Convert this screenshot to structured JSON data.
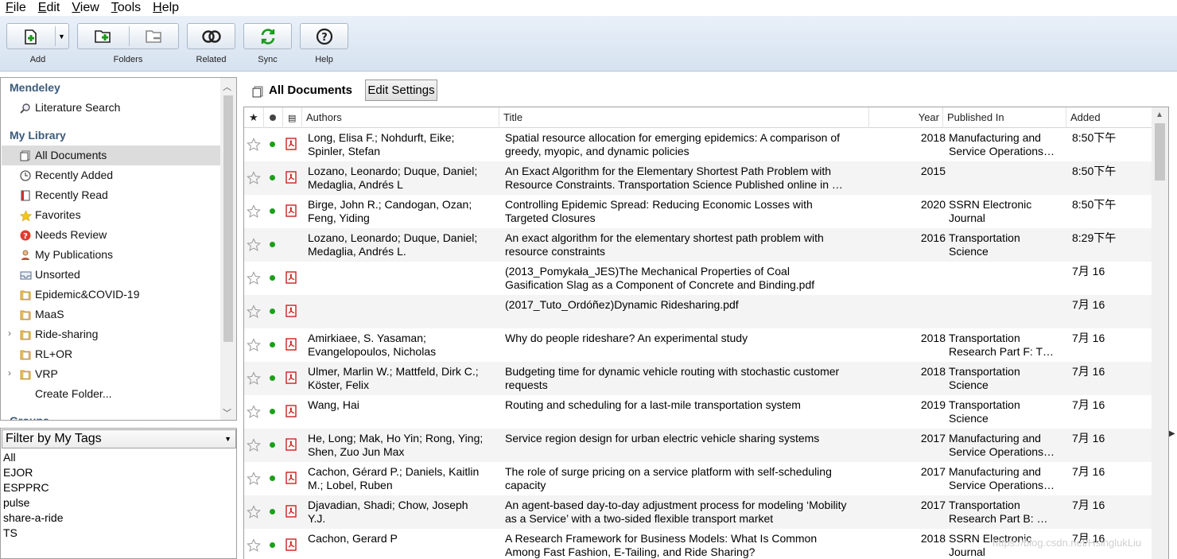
{
  "menu": {
    "file": {
      "u": "F",
      "rest": "ile"
    },
    "edit": {
      "u": "E",
      "rest": "dit"
    },
    "view": {
      "u": "V",
      "rest": "iew"
    },
    "tools": {
      "u": "T",
      "rest": "ools"
    },
    "help": {
      "u": "H",
      "rest": "elp"
    }
  },
  "toolbar": {
    "add": "Add",
    "folders": "Folders",
    "related": "Related",
    "sync": "Sync",
    "help": "Help"
  },
  "sidebar": {
    "mendeley_header": "Mendeley",
    "literature_search": "Literature Search",
    "library_header": "My Library",
    "items": [
      {
        "label": "All Documents"
      },
      {
        "label": "Recently Added"
      },
      {
        "label": "Recently Read"
      },
      {
        "label": "Favorites"
      },
      {
        "label": "Needs Review"
      },
      {
        "label": "My Publications"
      },
      {
        "label": "Unsorted"
      },
      {
        "label": "Epidemic&COVID-19"
      },
      {
        "label": "MaaS"
      },
      {
        "label": "Ride-sharing"
      },
      {
        "label": "RL+OR"
      },
      {
        "label": "VRP"
      },
      {
        "label": "Create Folder..."
      }
    ],
    "groups_header": "Groups"
  },
  "tags": {
    "filter_label": "Filter by My Tags",
    "list": [
      "All",
      "EJOR",
      "ESPPRC",
      "pulse",
      "share-a-ride",
      "TS"
    ]
  },
  "docs_header": {
    "title": "All Documents",
    "edit_settings": "Edit Settings"
  },
  "table": {
    "columns": {
      "authors": "Authors",
      "title": "Title",
      "year": "Year",
      "published_in": "Published In",
      "added": "Added"
    },
    "rows": [
      {
        "authors": [
          "Long, Elisa F.; Nohdurft, Eike;",
          "Spinler, Stefan"
        ],
        "title": [
          "Spatial resource allocation for emerging epidemics: A comparison of",
          "greedy, myopic, and dynamic policies"
        ],
        "year": "2018",
        "pub": [
          "Manufacturing and",
          "Service Operations…"
        ],
        "added": "8:50下午",
        "pdf": true
      },
      {
        "authors": [
          "Lozano, Leonardo; Duque, Daniel;",
          "Medaglia, Andrés L"
        ],
        "title": [
          "An Exact Algorithm for the Elementary Shortest Path Problem with",
          "Resource Constraints. Transportation Science Published online in …"
        ],
        "year": "2015",
        "pub": [
          "",
          ""
        ],
        "added": "8:50下午",
        "pdf": true
      },
      {
        "authors": [
          "Birge, John R.; Candogan, Ozan;",
          "Feng, Yiding"
        ],
        "title": [
          "Controlling Epidemic Spread: Reducing Economic Losses with",
          "Targeted Closures"
        ],
        "year": "2020",
        "pub": [
          "SSRN Electronic",
          "Journal"
        ],
        "added": "8:50下午",
        "pdf": true
      },
      {
        "authors": [
          "Lozano, Leonardo; Duque, Daniel;",
          "Medaglia, Andrés L."
        ],
        "title": [
          "An exact algorithm for the elementary shortest path problem with",
          "resource constraints"
        ],
        "year": "2016",
        "pub": [
          "Transportation",
          "Science"
        ],
        "added": "8:29下午",
        "pdf": false
      },
      {
        "authors": [
          "",
          ""
        ],
        "title": [
          "(2013_Pomykała_JES)The Mechanical Properties of Coal",
          "Gasification Slag as a Component of Concrete and Binding.pdf"
        ],
        "year": "",
        "pub": [
          "",
          ""
        ],
        "added": "7月 16",
        "pdf": true
      },
      {
        "authors": [
          "",
          ""
        ],
        "title": [
          "(2017_Tuto_Ordóñez)Dynamic Ridesharing.pdf",
          ""
        ],
        "year": "",
        "pub": [
          "",
          ""
        ],
        "added": "7月 16",
        "pdf": true
      },
      {
        "authors": [
          "Amirkiaee, S. Yasaman;",
          "Evangelopoulos, Nicholas"
        ],
        "title": [
          "Why do people rideshare? An experimental study",
          ""
        ],
        "year": "2018",
        "pub": [
          "Transportation",
          "Research Part F: T…"
        ],
        "added": "7月 16",
        "pdf": true
      },
      {
        "authors": [
          "Ulmer, Marlin W.; Mattfeld, Dirk C.;",
          "Köster, Felix"
        ],
        "title": [
          "Budgeting time for dynamic vehicle routing with stochastic customer",
          "requests"
        ],
        "year": "2018",
        "pub": [
          "Transportation",
          "Science"
        ],
        "added": "7月 16",
        "pdf": true
      },
      {
        "authors": [
          "Wang, Hai",
          ""
        ],
        "title": [
          "Routing and scheduling for a last-mile transportation system",
          ""
        ],
        "year": "2019",
        "pub": [
          "Transportation",
          "Science"
        ],
        "added": "7月 16",
        "pdf": true
      },
      {
        "authors": [
          "He, Long; Mak, Ho Yin; Rong, Ying;",
          "Shen, Zuo Jun Max"
        ],
        "title": [
          "Service region design for urban electric vehicle sharing systems",
          ""
        ],
        "year": "2017",
        "pub": [
          "Manufacturing and",
          "Service Operations…"
        ],
        "added": "7月 16",
        "pdf": true
      },
      {
        "authors": [
          "Cachon, Gérard P.; Daniels, Kaitlin",
          "M.; Lobel, Ruben"
        ],
        "title": [
          "The role of surge pricing on a service platform with self-scheduling",
          "capacity"
        ],
        "year": "2017",
        "pub": [
          "Manufacturing and",
          "Service Operations…"
        ],
        "added": "7月 16",
        "pdf": true
      },
      {
        "authors": [
          "Djavadian, Shadi; Chow, Joseph",
          "Y.J."
        ],
        "title": [
          "An agent-based day-to-day adjustment process for modeling ‘Mobility",
          "as a Service’ with a two-sided flexible transport market"
        ],
        "year": "2017",
        "pub": [
          "Transportation",
          "Research Part B: …"
        ],
        "added": "7月 16",
        "pdf": true
      },
      {
        "authors": [
          "Cachon, Gerard P",
          ""
        ],
        "title": [
          "A Research Framework for Business Models: What Is Common",
          "Among Fast Fashion, E-Tailing, and Ride Sharing?"
        ],
        "year": "2018",
        "pub": [
          "SSRN Electronic",
          "Journal"
        ],
        "added": "7月 16",
        "pdf": true
      }
    ]
  },
  "watermark": "https://blog.csdn.net/HsinglukLiu",
  "colors": {
    "read_dot": "#1aa01a",
    "pdf_red": "#cc1f1f",
    "section_header": "#3b5a7a",
    "selected_bg": "#dcdcdc"
  }
}
